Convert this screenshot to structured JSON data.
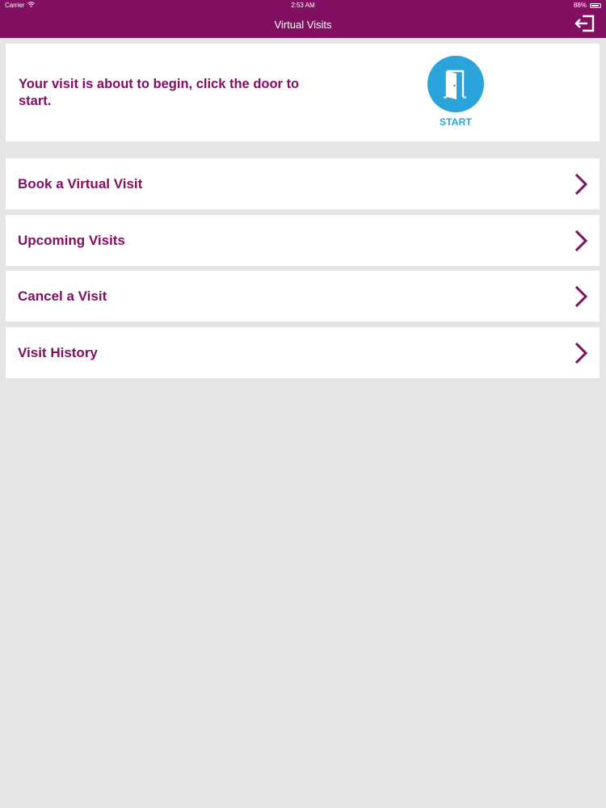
{
  "status_bar": {
    "carrier": "Carrier",
    "time": "2:53 AM",
    "battery": "88%"
  },
  "nav": {
    "title": "Virtual Visits",
    "logout_icon": "logout-arrow-icon"
  },
  "start_card": {
    "message": "Your visit is about to begin, click the door to start.",
    "button_label": "START",
    "icon": "door-icon"
  },
  "menu": {
    "items": [
      {
        "label": "Book a Virtual Visit"
      },
      {
        "label": "Upcoming Visits"
      },
      {
        "label": "Cancel a Visit"
      },
      {
        "label": "Visit History"
      }
    ]
  },
  "colors": {
    "brand": "#830f63",
    "accent": "#2aa4db",
    "background": "#e6e5e6"
  }
}
